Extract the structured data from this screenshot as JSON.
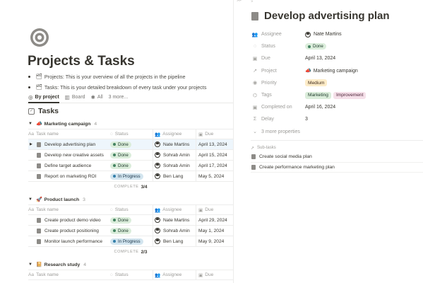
{
  "page": {
    "icon": "target-icon",
    "title": "Projects & Tasks",
    "bullets": [
      {
        "icon": "folders-icon",
        "text": "Projects: This is your overview of all the projects in the pipeline"
      },
      {
        "icon": "checklist-icon",
        "text": "Tasks: This is your detailed breakdown of every task under your projects"
      }
    ]
  },
  "views": [
    {
      "icon": "target-icon",
      "label": "By project"
    },
    {
      "icon": "board-icon",
      "label": "Board"
    },
    {
      "icon": "star-icon",
      "label": "All"
    },
    {
      "label": "3 more..."
    }
  ],
  "database": {
    "icon": "checkbox-icon",
    "title": "Tasks"
  },
  "columns": {
    "name": "Task name",
    "status": "Status",
    "assignee": "Assignee",
    "due": "Due"
  },
  "groups": [
    {
      "name": "Marketing campaign",
      "icon": "megaphone-icon",
      "count": "4",
      "rows": [
        {
          "name": "Develop advertising plan",
          "status": "Done",
          "status_type": "done",
          "assignee": "Nate Martins",
          "due": "April 13, 2024"
        },
        {
          "name": "Develop new creative assets",
          "status": "Done",
          "status_type": "done",
          "assignee": "Sohrab Amin",
          "due": "April 15, 2024"
        },
        {
          "name": "Define target audience",
          "status": "Done",
          "status_type": "done",
          "assignee": "Sohrab Amin",
          "due": "April 17, 2024"
        },
        {
          "name": "Report on marketing ROI",
          "status": "In Progress",
          "status_type": "progress",
          "assignee": "Ben Lang",
          "due": "May 5, 2024"
        }
      ],
      "complete_label": "COMPLETE",
      "complete_value": "3/4"
    },
    {
      "name": "Product launch",
      "icon": "rocket-icon",
      "count": "3",
      "rows": [
        {
          "name": "Create product demo video",
          "status": "Done",
          "status_type": "done",
          "assignee": "Nate Martins",
          "due": "April 29, 2024"
        },
        {
          "name": "Create product positioning",
          "status": "Done",
          "status_type": "done",
          "assignee": "Sohrab Amin",
          "due": "May 1, 2024"
        },
        {
          "name": "Monitor launch performance",
          "status": "In Progress",
          "status_type": "progress",
          "assignee": "Ben Lang",
          "due": "May 9, 2024"
        }
      ],
      "complete_label": "COMPLETE",
      "complete_value": "2/3"
    },
    {
      "name": "Research study",
      "icon": "notebook-icon",
      "count": "4",
      "rows": [],
      "complete_label": "",
      "complete_value": ""
    }
  ],
  "panel": {
    "title": "Develop advertising plan",
    "properties": [
      {
        "label": "Assignee",
        "icon": "people-icon",
        "value": "Nate Martins"
      },
      {
        "label": "Status",
        "icon": "status-icon",
        "value": "Done"
      },
      {
        "label": "Due",
        "icon": "calendar-icon",
        "value": "April 13, 2024"
      },
      {
        "label": "Project",
        "icon": "relation-icon",
        "value": "Marketing campaign"
      },
      {
        "label": "Priority",
        "icon": "priority-icon",
        "value": "Medium"
      },
      {
        "label": "Tags",
        "icon": "tag-icon",
        "values": [
          "Marketing",
          "Improvement"
        ]
      },
      {
        "label": "Completed on",
        "icon": "calendar-icon",
        "value": "April 16, 2024"
      },
      {
        "label": "Delay",
        "icon": "formula-icon",
        "value": "3"
      }
    ],
    "more_properties": "3 more properties",
    "subtasks_label": "Sub-tasks",
    "subtasks": [
      "Create social media plan",
      "Create performance marketing plan"
    ]
  },
  "colors": {
    "done": "#dbeddb",
    "in_progress": "#d3e5ef",
    "medium": "#fdecc8",
    "improvement": "#f5e0e9",
    "selected_row": "#eef6fc"
  }
}
